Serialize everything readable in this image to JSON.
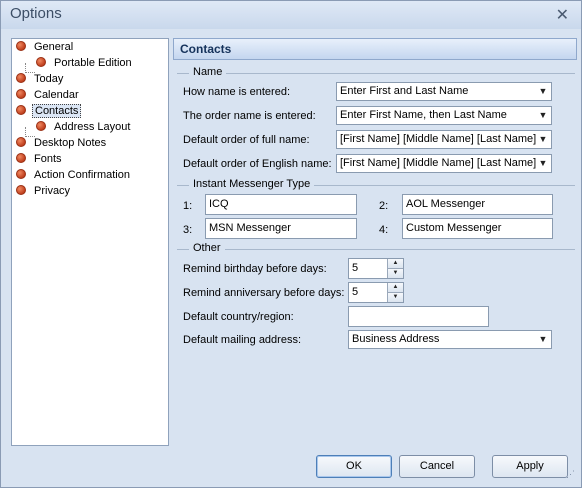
{
  "window": {
    "title": "Options",
    "close": "✕"
  },
  "tree": {
    "items": [
      {
        "label": "General"
      },
      {
        "label": "Portable Edition"
      },
      {
        "label": "Today"
      },
      {
        "label": "Calendar"
      },
      {
        "label": "Contacts",
        "selected": true
      },
      {
        "label": "Address Layout"
      },
      {
        "label": "Desktop Notes"
      },
      {
        "label": "Fonts"
      },
      {
        "label": "Action Confirmation"
      },
      {
        "label": "Privacy"
      }
    ]
  },
  "panel": {
    "title": "Contacts"
  },
  "name_group": {
    "title": "Name",
    "how_label": "How name is entered:",
    "how_value": "Enter First and Last Name",
    "order_label": "The order name is entered:",
    "order_value": "Enter First Name, then Last Name",
    "full_label": "Default order of full name:",
    "full_value": "[First Name] [Middle Name] [Last Name]",
    "english_label": "Default order of English name:",
    "english_value": "[First Name] [Middle Name] [Last Name]"
  },
  "im_group": {
    "title": "Instant Messenger Type",
    "entries": [
      {
        "num": "1:",
        "value": "ICQ"
      },
      {
        "num": "2:",
        "value": "AOL Messenger"
      },
      {
        "num": "3:",
        "value": "MSN Messenger"
      },
      {
        "num": "4:",
        "value": "Custom Messenger"
      }
    ]
  },
  "other_group": {
    "title": "Other",
    "birthday_label": "Remind birthday before days:",
    "birthday_value": "5",
    "anniversary_label": "Remind anniversary before days:",
    "anniversary_value": "5",
    "country_label": "Default country/region:",
    "country_value": "",
    "mailing_label": "Default mailing address:",
    "mailing_value": "Business Address"
  },
  "buttons": {
    "ok": "OK",
    "cancel": "Cancel",
    "apply": "Apply"
  },
  "icons": {
    "spin_up": "▲",
    "spin_down": "▼",
    "dropdown": "▼",
    "grip": "⋰"
  }
}
